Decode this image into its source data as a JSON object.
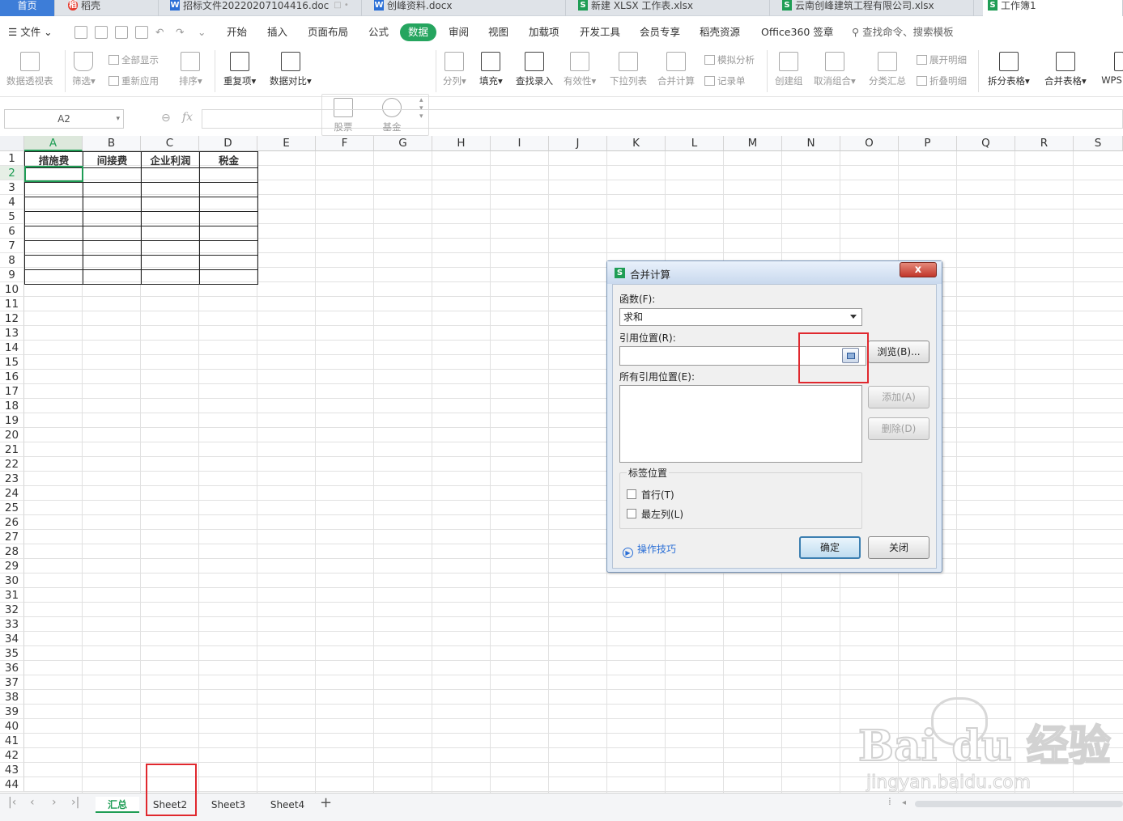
{
  "tabs": [
    {
      "label": "首页",
      "type": "home"
    },
    {
      "label": "稻壳",
      "icon": "daoke-icon"
    },
    {
      "label": "招标文件20220207104416.doc",
      "icon": "word-icon"
    },
    {
      "label": "创峰资料.docx",
      "icon": "word-icon"
    },
    {
      "label": "新建 XLSX 工作表.xlsx",
      "icon": "sheet-icon"
    },
    {
      "label": "云南创峰建筑工程有限公司.xlsx",
      "icon": "sheet-icon"
    },
    {
      "label": "工作簿1",
      "icon": "sheet-icon",
      "active": true
    }
  ],
  "menu": {
    "file": "文件",
    "items": [
      "开始",
      "插入",
      "页面布局",
      "公式",
      "数据",
      "审阅",
      "视图",
      "加载项",
      "开发工具",
      "会员专享",
      "稻壳资源",
      "Office360 签章"
    ],
    "active": "数据",
    "search": "查找命令、搜索模板"
  },
  "ribbon": {
    "pivot": "数据透视表",
    "filter": "筛选",
    "show_all": "全部显示",
    "reapply": "重新应用",
    "sort": "排序",
    "duplicates": "重复项",
    "compare": "数据对比",
    "stock": "股票",
    "fund": "基金",
    "split": "分列",
    "fill": "填充",
    "lookup": "查找录入",
    "validity": "有效性",
    "dropdown": "下拉列表",
    "consolidate": "合并计算",
    "simulate": "模拟分析",
    "record": "记录单",
    "group": "创建组",
    "ungroup": "取消组合",
    "subtotal": "分类汇总",
    "expand": "展开明细",
    "collapse": "折叠明细",
    "split_table": "拆分表格",
    "merge_table": "合并表格",
    "wps": "WPS"
  },
  "formula_bar": {
    "name_box": "A2",
    "fx": "fx",
    "value": ""
  },
  "columns": [
    "A",
    "B",
    "C",
    "D",
    "E",
    "F",
    "G",
    "H",
    "I",
    "J",
    "K",
    "L",
    "M",
    "N",
    "O",
    "P",
    "Q",
    "R",
    "S"
  ],
  "selected_column": "A",
  "selected_row": 2,
  "row_count": 44,
  "table": {
    "headers": [
      "措施费",
      "间接费",
      "企业利润",
      "税金"
    ],
    "empty_rows": 8
  },
  "sheets": [
    "汇总",
    "Sheet2",
    "Sheet3",
    "Sheet4"
  ],
  "active_sheet": "汇总",
  "dialog": {
    "title": "合并计算",
    "close": "x",
    "function_label": "函数(F):",
    "function_value": "求和",
    "ref_label": "引用位置(R):",
    "ref_value": "",
    "browse": "浏览(B)...",
    "all_refs_label": "所有引用位置(E):",
    "add": "添加(A)",
    "delete": "删除(D)",
    "label_group": "标签位置",
    "top_row": "首行(T)",
    "left_col": "最左列(L)",
    "tips": "操作技巧",
    "ok": "确定",
    "cancel": "关闭"
  },
  "watermark": {
    "main": "Bai du 经验",
    "sub": "jingyan.baidu.com"
  },
  "colors": {
    "accent": "#1f9d55",
    "home_tab": "#3d7dd8",
    "highlight": "#e0282e"
  }
}
